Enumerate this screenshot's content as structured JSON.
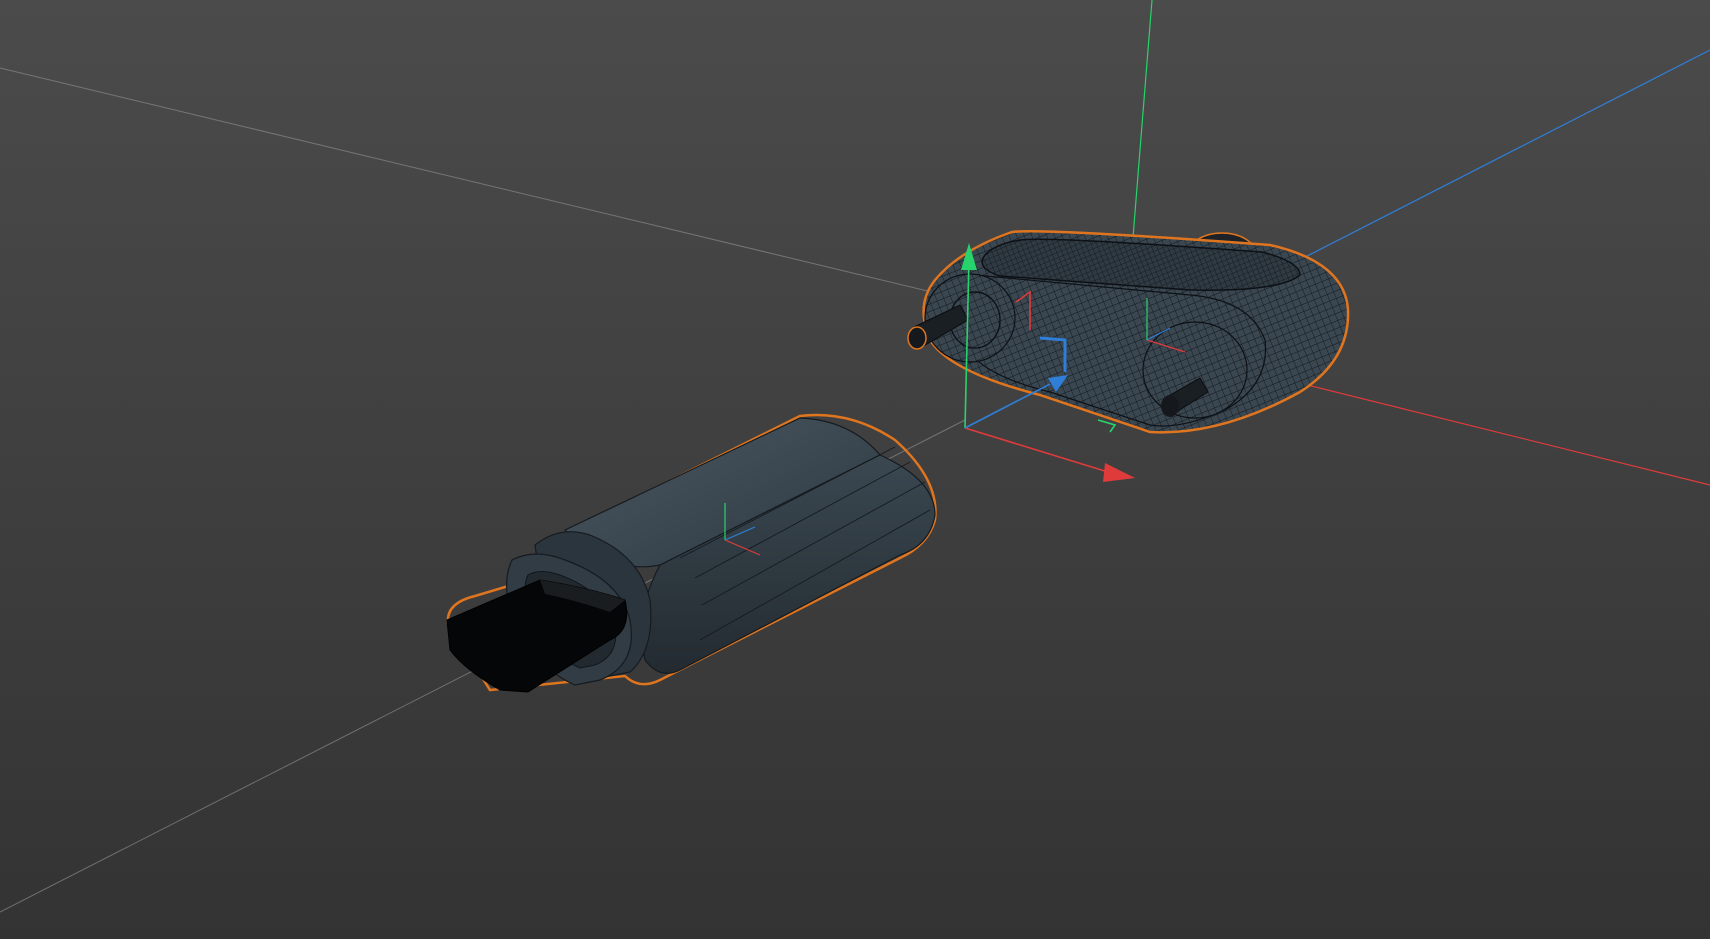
{
  "viewport": {
    "background_top": "#4b4b4b",
    "background_bottom": "#333333",
    "grid_axis_color": "#8a8a8a",
    "x_axis_color": "#e03b3b",
    "y_axis_color": "#27d36b",
    "z_axis_color": "#2f7fd8",
    "selection_outline_color": "#e0751f",
    "mesh_fill": "#3a4650",
    "mesh_dark": "#1e2328",
    "wire_color": "#11161b"
  },
  "scene": {
    "objects": [
      {
        "name": "usb-plug-body",
        "selected": true
      },
      {
        "name": "connector-housing-with-screws",
        "selected": true
      }
    ],
    "gizmo": {
      "mode": "move",
      "icon": "move-gizmo-icon"
    }
  }
}
